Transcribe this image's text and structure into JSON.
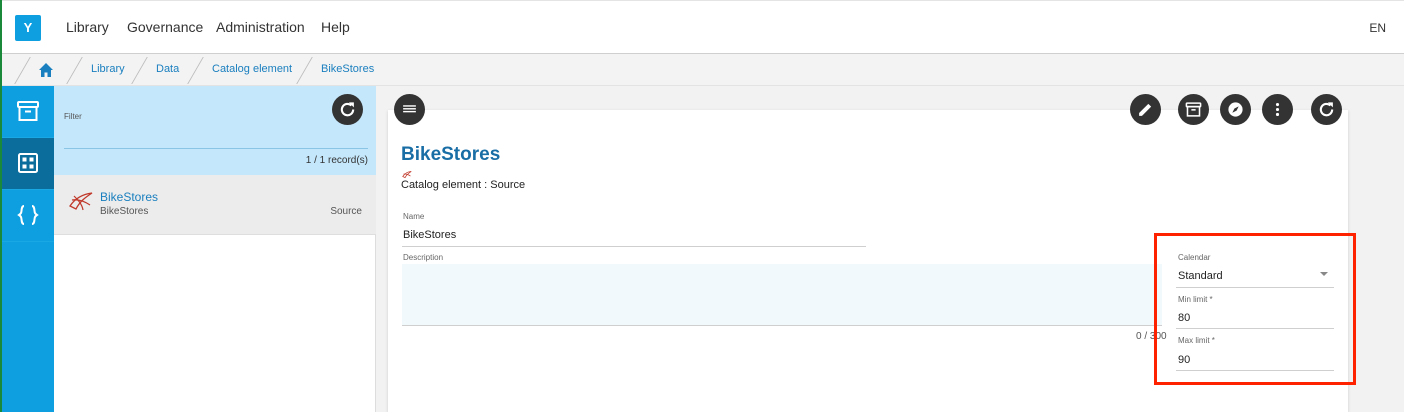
{
  "topnav": {
    "logo": "Y",
    "items": [
      "Library",
      "Governance",
      "Administration",
      "Help"
    ],
    "lang": "EN"
  },
  "breadcrumb": [
    "Library",
    "Data",
    "Catalog element",
    "BikeStores"
  ],
  "list": {
    "filter_label": "Filter",
    "count": "1 / 1 record(s)",
    "rows": [
      {
        "title": "BikeStores",
        "subtitle": "BikeStores",
        "type": "Source"
      }
    ]
  },
  "detail": {
    "title": "BikeStores",
    "subtitle": "Catalog element : Source",
    "name_label": "Name",
    "name_value": "BikeStores",
    "description_label": "Description",
    "description_counter": "0 / 300",
    "calendar_label": "Calendar",
    "calendar_value": "Standard",
    "min_label": "Min limit *",
    "min_value": "80",
    "max_label": "Max limit *",
    "max_value": "90"
  },
  "colors": {
    "accent": "#0e9fe0",
    "highlight": "#ff2200"
  }
}
